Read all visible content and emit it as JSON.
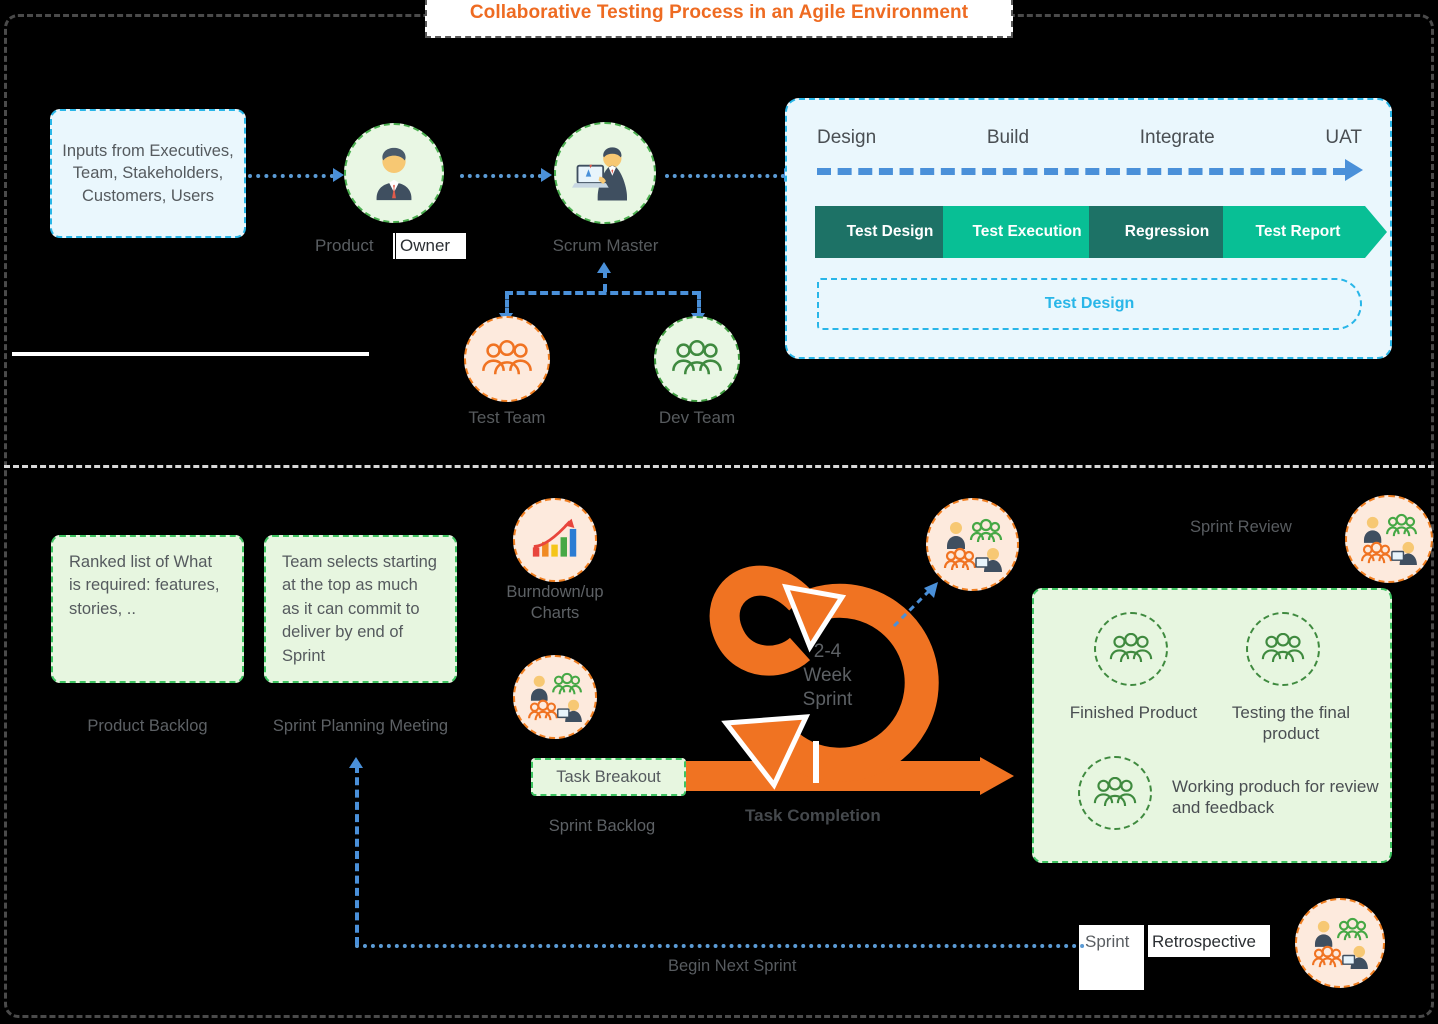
{
  "title": "Collaborative Testing Process in an Agile Environment",
  "top_section": {
    "input_card": "Inputs from Executives, Team, Stakeholders, Customers, Users",
    "roles": [
      {
        "label": "Product Owner",
        "icon": "businessman-icon",
        "tone": "green"
      },
      {
        "label": "Scrum Master",
        "icon": "presenter-laptop-icon",
        "tone": "green"
      },
      {
        "label": "Test Team",
        "icon": "people-group-icon",
        "tone": "peach"
      },
      {
        "label": "Dev Team",
        "icon": "people-group-icon",
        "tone": "green"
      }
    ],
    "product_owner_label_part1": "Product",
    "product_owner_label_part2": "Owner",
    "test_panel": {
      "phases": [
        "Design",
        "Build",
        "Integrate",
        "UAT"
      ],
      "chevrons": [
        {
          "label": "Test Design",
          "tone": "dark"
        },
        {
          "label": "Test Execution",
          "tone": "lite"
        },
        {
          "label": "Regression",
          "tone": "dark"
        },
        {
          "label": "Test Report",
          "tone": "lite"
        }
      ],
      "band_label": "Test Design"
    }
  },
  "bottom_section": {
    "product_backlog": {
      "note": "Ranked list of What is required: features, stories, ..",
      "label": "Product Backlog"
    },
    "sprint_planning": {
      "note": "Team selects starting at the top as much as it can commit to deliver by end of Sprint",
      "label": "Sprint Planning Meeting"
    },
    "burndown": {
      "label": "Burndown/up Charts",
      "icon": "bar-chart-growth-icon"
    },
    "sprint_backlog": {
      "task_box": "Task Breakout",
      "label": "Sprint Backlog",
      "icon": "team-meeting-icon"
    },
    "sprint_ring": {
      "line1": "2-4",
      "line2": "Week",
      "line3": "Sprint",
      "color": "#f07322"
    },
    "task_completion": "Task Completion",
    "daily_scrum_icon": "team-meeting-icon",
    "sprint_review": {
      "label": "Sprint Review",
      "icon": "team-meeting-icon"
    },
    "result_panel": {
      "items": [
        {
          "label": "Finished Product",
          "icon": "people-group-icon"
        },
        {
          "label": "Testing the final product",
          "icon": "people-group-icon"
        },
        {
          "label": "Working produch for review and feedback",
          "icon": "people-group-icon"
        }
      ]
    },
    "sprint_retrospective": {
      "part1": "Sprint",
      "part2": "Retrospective",
      "icon": "team-meeting-icon"
    },
    "begin_next_sprint": "Begin Next Sprint"
  },
  "colors": {
    "accent_orange": "#ee6b22",
    "blue": "#29b6e8",
    "green": "#3ec461",
    "teal_dark": "#1d7266",
    "teal_light": "#08bf95",
    "arrow_blue": "#4a90d9"
  }
}
